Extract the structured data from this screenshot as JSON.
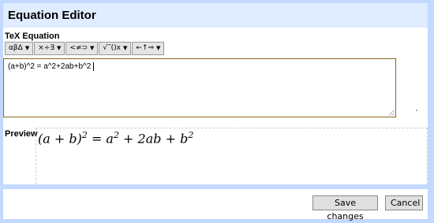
{
  "dialog": {
    "title": "Equation Editor"
  },
  "editor_section": {
    "label": "TeX Equation"
  },
  "toolbar": {
    "groups": [
      {
        "label": "αβΔ",
        "arrow": "▼"
      },
      {
        "label": "×÷∃",
        "arrow": "▼"
      },
      {
        "label": "<≠⊃",
        "arrow": "▼"
      },
      {
        "label": "√‾()x",
        "arrow": "▼"
      },
      {
        "label": "←↑⇒",
        "arrow": "▼"
      }
    ]
  },
  "editor": {
    "value": "(a+b)^2 = a^2+2ab+b^2"
  },
  "preview": {
    "label": "Preview",
    "lhs_base": "(a + b)",
    "lhs_exp": "2",
    "eq": " = ",
    "t1_base": "a",
    "t1_exp": "2",
    "t2": " + 2ab + ",
    "t3_base": "b",
    "t3_exp": "2"
  },
  "footer": {
    "save_label": "Save changes",
    "cancel_label": "Cancel"
  }
}
